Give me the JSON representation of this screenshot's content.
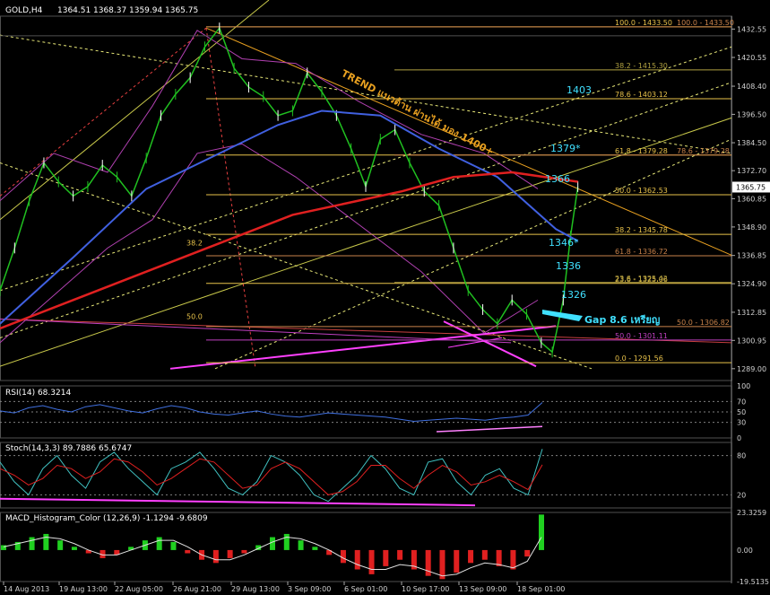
{
  "chart_data": {
    "type": "line",
    "header": {
      "symbol": "GOLD,H4",
      "ohlc": [
        "1364.51",
        "1368.37",
        "1359.94",
        "1365.75"
      ]
    },
    "price_axis": {
      "min": 1284,
      "max": 1438,
      "ticks": [
        "1432.55",
        "1420.55",
        "1408.40",
        "1396.50",
        "1384.50",
        "1372.70",
        "1360.85",
        "1348.90",
        "1336.85",
        "1324.90",
        "1312.85",
        "1300.95",
        "1289.00"
      ],
      "last_price": "1365.75"
    },
    "time_labels": [
      "14 Aug 2013",
      "19 Aug 13:00",
      "22 Aug 05:00",
      "26 Aug 21:00",
      "29 Aug 13:00",
      "3 Sep 09:00",
      "6 Sep 01:00",
      "10 Sep 17:00",
      "13 Sep 09:00",
      "18 Sep 01:00"
    ],
    "fib_levels": [
      {
        "label": "100.0 - 1433.50",
        "price": 1433.5,
        "color": "#e8c24a"
      },
      {
        "label": "100.0 - 1433.50",
        "price": 1433.5,
        "color": "#c8824a"
      },
      {
        "label": "38.2 - 1415.30",
        "price": 1415.3,
        "color": "#b0a040"
      },
      {
        "label": "78.6 - 1403.12",
        "price": 1403.12,
        "color": "#e8c24a"
      },
      {
        "label": "61.8 - 1379.28",
        "price": 1379.28,
        "color": "#e8c24a"
      },
      {
        "label": "78.6 - 1379.28",
        "price": 1379.28,
        "color": "#c8824a"
      },
      {
        "label": "50.0 - 1362.53",
        "price": 1362.53,
        "color": "#e8c24a"
      },
      {
        "label": "38.2 - 1345.78",
        "price": 1345.78,
        "color": "#e8c24a"
      },
      {
        "label": "61.8 - 1336.72",
        "price": 1336.72,
        "color": "#c8824a"
      },
      {
        "label": "23.6 - 1325.06",
        "price": 1325.06,
        "color": "#e8c24a"
      },
      {
        "label": "23.6 - 1325.42",
        "price": 1325.42,
        "color": "#b0a040"
      },
      {
        "label": "50.0 - 1306.82",
        "price": 1306.82,
        "color": "#c8824a"
      },
      {
        "label": "50.0 - 1301.11",
        "price": 1301.11,
        "color": "#c040c0"
      },
      {
        "label": "0.0 - 1291.56",
        "price": 1291.56,
        "color": "#e8c24a"
      }
    ],
    "side_fib_labels": [
      {
        "label": "38.2",
        "price": 1341.0
      },
      {
        "label": "50.0",
        "price": 1310.0
      }
    ],
    "annotations": {
      "trend_text": "TREND แนวต้าน ผ่านได้ มอง 1400+",
      "gap_text": "Gap 8.6 เหรียญ",
      "price_labels": [
        "1403",
        "1379*",
        "1366",
        "1346*",
        "1336",
        "1326"
      ]
    },
    "price_series": [
      {
        "t": 0.0,
        "v": 1322
      },
      {
        "t": 0.02,
        "v": 1340
      },
      {
        "t": 0.04,
        "v": 1360
      },
      {
        "t": 0.06,
        "v": 1376
      },
      {
        "t": 0.08,
        "v": 1368
      },
      {
        "t": 0.1,
        "v": 1362
      },
      {
        "t": 0.12,
        "v": 1366
      },
      {
        "t": 0.14,
        "v": 1375
      },
      {
        "t": 0.16,
        "v": 1370
      },
      {
        "t": 0.18,
        "v": 1362
      },
      {
        "t": 0.2,
        "v": 1378
      },
      {
        "t": 0.22,
        "v": 1396
      },
      {
        "t": 0.24,
        "v": 1405
      },
      {
        "t": 0.26,
        "v": 1412
      },
      {
        "t": 0.28,
        "v": 1425
      },
      {
        "t": 0.3,
        "v": 1433
      },
      {
        "t": 0.32,
        "v": 1416
      },
      {
        "t": 0.34,
        "v": 1408
      },
      {
        "t": 0.36,
        "v": 1404
      },
      {
        "t": 0.38,
        "v": 1396
      },
      {
        "t": 0.4,
        "v": 1398
      },
      {
        "t": 0.42,
        "v": 1414
      },
      {
        "t": 0.44,
        "v": 1406
      },
      {
        "t": 0.46,
        "v": 1396
      },
      {
        "t": 0.48,
        "v": 1382
      },
      {
        "t": 0.5,
        "v": 1366
      },
      {
        "t": 0.52,
        "v": 1386
      },
      {
        "t": 0.54,
        "v": 1390
      },
      {
        "t": 0.56,
        "v": 1376
      },
      {
        "t": 0.58,
        "v": 1364
      },
      {
        "t": 0.6,
        "v": 1358
      },
      {
        "t": 0.62,
        "v": 1340
      },
      {
        "t": 0.64,
        "v": 1322
      },
      {
        "t": 0.66,
        "v": 1314
      },
      {
        "t": 0.68,
        "v": 1308
      },
      {
        "t": 0.7,
        "v": 1318
      },
      {
        "t": 0.72,
        "v": 1312
      },
      {
        "t": 0.74,
        "v": 1300
      },
      {
        "t": 0.755,
        "v": 1296
      },
      {
        "t": 0.77,
        "v": 1318
      },
      {
        "t": 0.78,
        "v": 1345
      },
      {
        "t": 0.79,
        "v": 1366
      }
    ],
    "ma_blue": [
      {
        "t": 0.0,
        "v": 1308
      },
      {
        "t": 0.1,
        "v": 1336
      },
      {
        "t": 0.2,
        "v": 1365
      },
      {
        "t": 0.3,
        "v": 1380
      },
      {
        "t": 0.38,
        "v": 1392
      },
      {
        "t": 0.44,
        "v": 1398
      },
      {
        "t": 0.52,
        "v": 1396
      },
      {
        "t": 0.6,
        "v": 1382
      },
      {
        "t": 0.68,
        "v": 1370
      },
      {
        "t": 0.76,
        "v": 1348
      },
      {
        "t": 0.79,
        "v": 1343
      }
    ],
    "ma_red": [
      {
        "t": 0.0,
        "v": 1306
      },
      {
        "t": 0.2,
        "v": 1330
      },
      {
        "t": 0.4,
        "v": 1354
      },
      {
        "t": 0.55,
        "v": 1364
      },
      {
        "t": 0.62,
        "v": 1370
      },
      {
        "t": 0.7,
        "v": 1372
      },
      {
        "t": 0.79,
        "v": 1368
      }
    ],
    "rsi": {
      "label": "RSI(14) 68.3214",
      "ticks": [
        "100",
        "70",
        "50",
        "30",
        "0"
      ],
      "values": [
        52,
        48,
        58,
        62,
        55,
        50,
        60,
        64,
        58,
        52,
        48,
        56,
        62,
        58,
        50,
        46,
        44,
        48,
        52,
        46,
        42,
        40,
        44,
        48,
        46,
        44,
        42,
        40,
        36,
        32,
        34,
        36,
        38,
        36,
        34,
        38,
        40,
        44,
        68
      ]
    },
    "stoch": {
      "label": "Stoch(14,3,3) 89.7886 65.6747",
      "ticks": [
        "80",
        "20"
      ],
      "main": [
        70,
        40,
        20,
        60,
        80,
        50,
        30,
        70,
        85,
        60,
        40,
        20,
        60,
        70,
        85,
        60,
        30,
        20,
        40,
        80,
        70,
        50,
        20,
        10,
        30,
        50,
        80,
        60,
        30,
        20,
        70,
        75,
        40,
        20,
        50,
        60,
        30,
        20,
        90
      ],
      "signal": [
        60,
        50,
        35,
        45,
        65,
        60,
        45,
        55,
        75,
        70,
        55,
        35,
        45,
        60,
        75,
        70,
        50,
        30,
        35,
        60,
        70,
        60,
        40,
        20,
        25,
        40,
        65,
        65,
        45,
        30,
        50,
        65,
        55,
        35,
        40,
        50,
        40,
        28,
        66
      ]
    },
    "macd": {
      "label": "MACD_Histogram_Color (12,26,9) -1.1294 -9.6809",
      "ticks": [
        "23.3259",
        "0.00",
        "-19.5135"
      ],
      "values": [
        3,
        5,
        8,
        10,
        6,
        2,
        -2,
        -5,
        -3,
        2,
        6,
        8,
        5,
        -2,
        -6,
        -8,
        -5,
        -2,
        3,
        8,
        10,
        6,
        2,
        -3,
        -8,
        -12,
        -15,
        -10,
        -6,
        -12,
        -16,
        -18,
        -14,
        -8,
        -6,
        -10,
        -12,
        -4,
        22
      ],
      "signal": [
        2,
        4,
        6,
        8,
        7,
        4,
        0,
        -3,
        -3,
        0,
        3,
        6,
        6,
        2,
        -3,
        -6,
        -6,
        -3,
        1,
        5,
        8,
        7,
        4,
        0,
        -5,
        -9,
        -12,
        -12,
        -9,
        -10,
        -13,
        -16,
        -15,
        -11,
        -8,
        -9,
        -11,
        -7,
        8
      ]
    }
  }
}
